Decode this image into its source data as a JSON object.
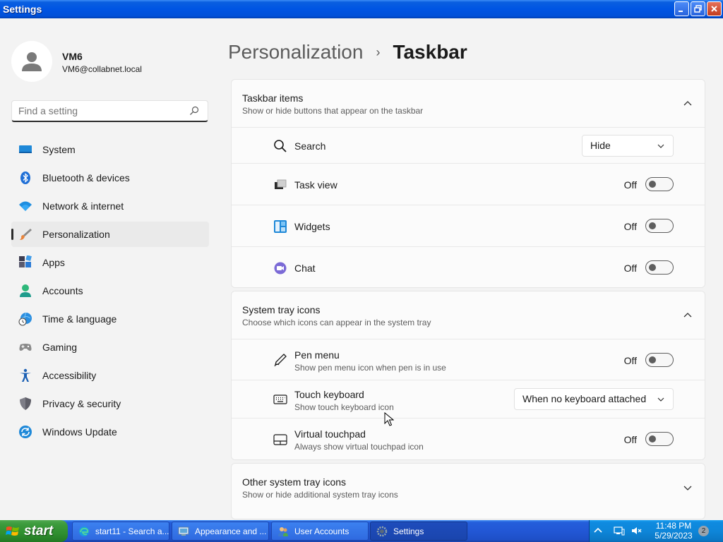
{
  "window": {
    "title": "Settings"
  },
  "user": {
    "name": "VM6",
    "email": "VM6@collabnet.local"
  },
  "search": {
    "placeholder": "Find a setting",
    "value": ""
  },
  "sidebar": {
    "items": [
      {
        "label": "System",
        "icon": "monitor-icon",
        "active": false
      },
      {
        "label": "Bluetooth & devices",
        "icon": "bluetooth-icon",
        "active": false
      },
      {
        "label": "Network & internet",
        "icon": "wifi-icon",
        "active": false
      },
      {
        "label": "Personalization",
        "icon": "paintbrush-icon",
        "active": true
      },
      {
        "label": "Apps",
        "icon": "apps-icon",
        "active": false
      },
      {
        "label": "Accounts",
        "icon": "person-icon",
        "active": false
      },
      {
        "label": "Time & language",
        "icon": "globe-clock-icon",
        "active": false
      },
      {
        "label": "Gaming",
        "icon": "gamepad-icon",
        "active": false
      },
      {
        "label": "Accessibility",
        "icon": "accessibility-icon",
        "active": false
      },
      {
        "label": "Privacy & security",
        "icon": "shield-icon",
        "active": false
      },
      {
        "label": "Windows Update",
        "icon": "update-icon",
        "active": false
      }
    ]
  },
  "breadcrumb": {
    "parent": "Personalization",
    "separator": "›",
    "current": "Taskbar"
  },
  "taskbar_items": {
    "title": "Taskbar items",
    "subtitle": "Show or hide buttons that appear on the taskbar",
    "rows": [
      {
        "label": "Search",
        "icon": "search-icon",
        "control": "dropdown",
        "value": "Hide"
      },
      {
        "label": "Task view",
        "icon": "task-view-icon",
        "control": "toggle",
        "state": "Off"
      },
      {
        "label": "Widgets",
        "icon": "widgets-icon",
        "control": "toggle",
        "state": "Off"
      },
      {
        "label": "Chat",
        "icon": "chat-icon",
        "control": "toggle",
        "state": "Off"
      }
    ]
  },
  "system_tray": {
    "title": "System tray icons",
    "subtitle": "Choose which icons can appear in the system tray",
    "rows": [
      {
        "label": "Pen menu",
        "sub": "Show pen menu icon when pen is in use",
        "icon": "pen-icon",
        "control": "toggle",
        "state": "Off"
      },
      {
        "label": "Touch keyboard",
        "sub": "Show touch keyboard icon",
        "icon": "keyboard-icon",
        "control": "dropdown",
        "value": "When no keyboard attached"
      },
      {
        "label": "Virtual touchpad",
        "sub": "Always show virtual touchpad icon",
        "icon": "touchpad-icon",
        "control": "toggle",
        "state": "Off"
      }
    ]
  },
  "other_tray": {
    "title": "Other system tray icons",
    "subtitle": "Show or hide additional system tray icons"
  },
  "os_taskbar": {
    "start_label": "start",
    "tasks": [
      {
        "label": "start11 - Search a...",
        "icon": "edge-icon",
        "active": false
      },
      {
        "label": "Appearance and ...",
        "icon": "control-panel-icon",
        "active": false
      },
      {
        "label": "User Accounts",
        "icon": "users-icon",
        "active": false
      },
      {
        "label": "Settings",
        "icon": "settings-gear-icon",
        "active": true
      }
    ],
    "clock_time": "11:48 PM",
    "clock_date": "5/29/2023",
    "notification_count": "2"
  },
  "colors": {
    "accent": "#0067c0",
    "xp_blue": "#0054e3",
    "start_green": "#3c9a3c"
  }
}
